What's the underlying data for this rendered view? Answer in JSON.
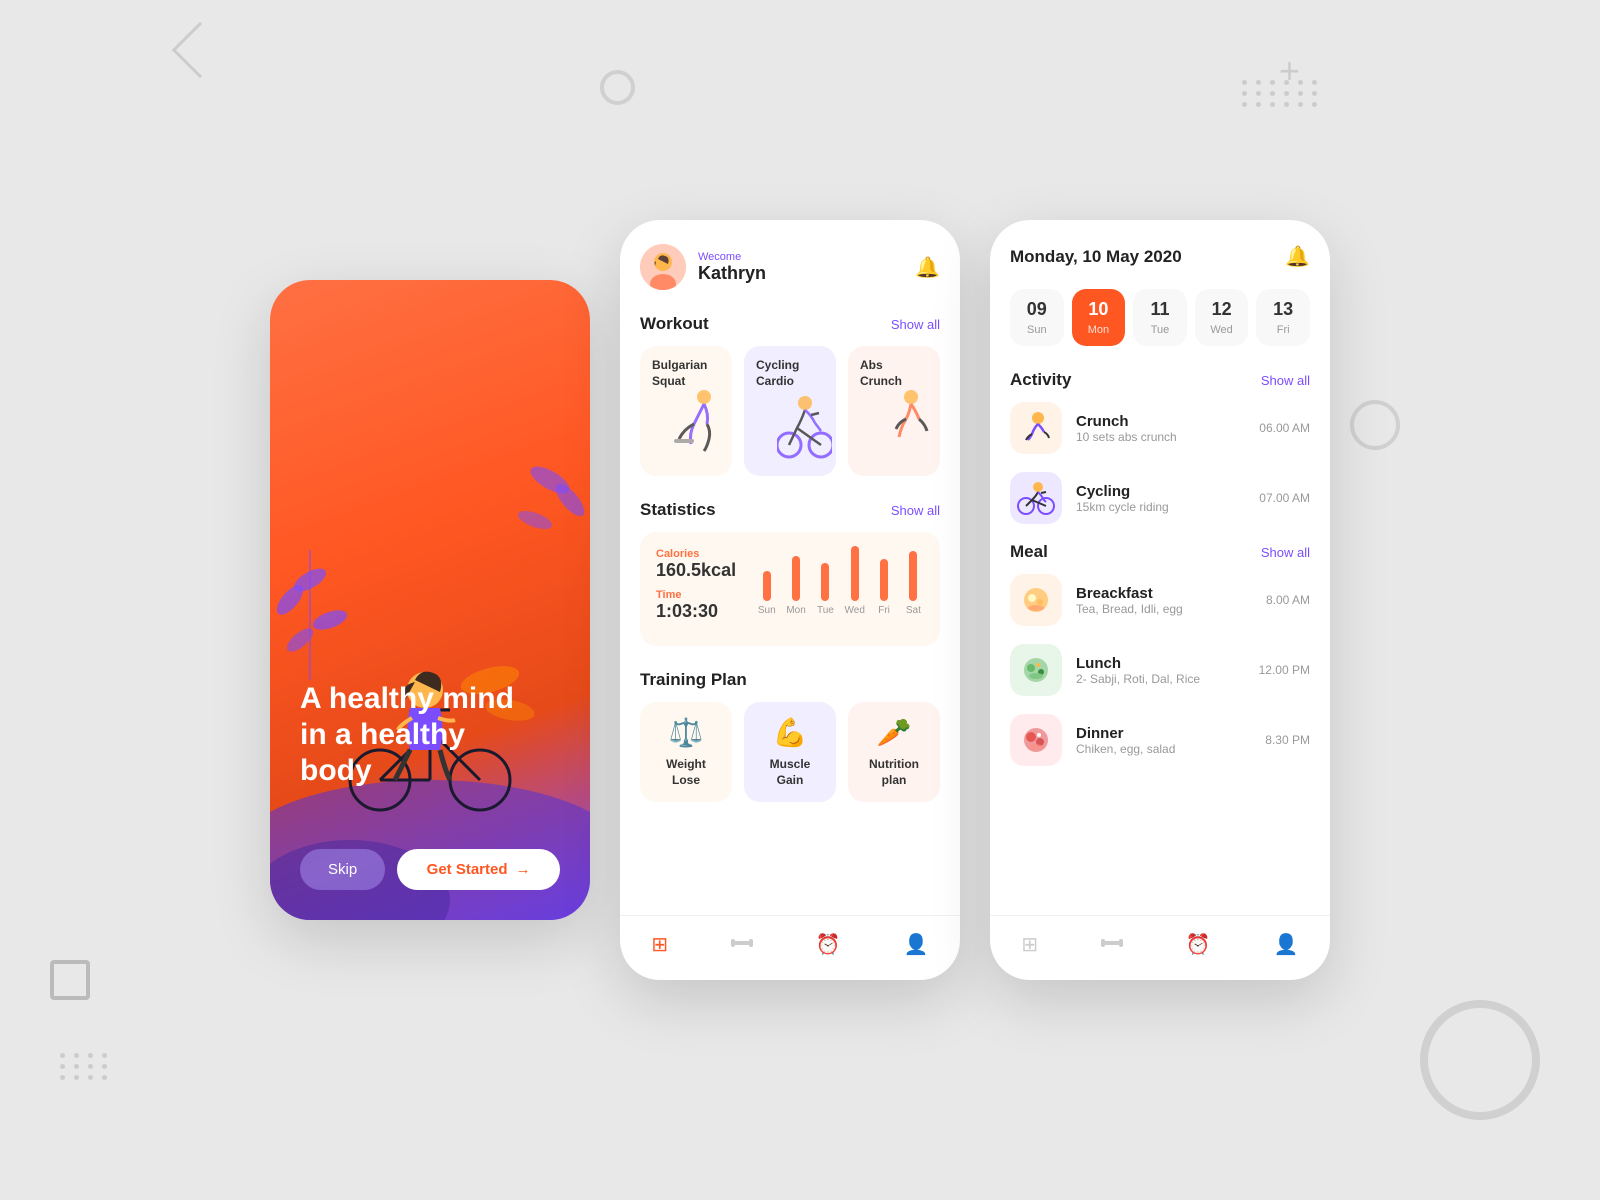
{
  "decorations": {
    "triangle": "▷",
    "plus": "+",
    "circle": "○"
  },
  "phone1": {
    "title_line1": "A healthy mind",
    "title_line2": "in a healthy",
    "title_line3": "body",
    "btn_skip": "Skip",
    "btn_get_started": "Get Started",
    "btn_arrow": "→"
  },
  "phone2": {
    "header": {
      "welcome_label": "Wecome",
      "user_name": "Kathryn"
    },
    "workout": {
      "section_title": "Workout",
      "show_all": "Show all",
      "cards": [
        {
          "title": "Bulgarian Squat",
          "bg": "cream",
          "emoji": "🏋️"
        },
        {
          "title": "Cycling Cardio",
          "bg": "lavender",
          "emoji": "🚴"
        },
        {
          "title": "Abs Crunch",
          "bg": "peach",
          "emoji": "💪"
        }
      ]
    },
    "statistics": {
      "section_title": "Statistics",
      "show_all": "Show all",
      "calories_label": "Calories",
      "calories_value": "160.5kcal",
      "time_label": "Time",
      "time_value": "1:03:30",
      "chart": {
        "days": [
          "Sun",
          "Mon",
          "Tue",
          "Wed",
          "Fri",
          "Sat"
        ],
        "heights": [
          30,
          45,
          38,
          55,
          42,
          50
        ]
      }
    },
    "training_plan": {
      "section_title": "Training Plan",
      "plans": [
        {
          "label": "Weight Lose",
          "icon": "⚖️",
          "bg": "cream"
        },
        {
          "label": "Muscle Gain",
          "icon": "💪",
          "bg": "purple-bg"
        },
        {
          "label": "Nutrition plan",
          "icon": "🥕",
          "bg": "pink-bg"
        }
      ]
    },
    "bottom_nav": {
      "icons": [
        "⊞",
        "⊟",
        "⏰",
        "👤"
      ]
    }
  },
  "phone3": {
    "header": {
      "date_title": "Monday, 10 May 2020"
    },
    "calendar": {
      "days": [
        {
          "num": "09",
          "name": "Sun",
          "active": false
        },
        {
          "num": "10",
          "name": "Mon",
          "active": true
        },
        {
          "num": "11",
          "name": "Tue",
          "active": false
        },
        {
          "num": "12",
          "name": "Wed",
          "active": false
        },
        {
          "num": "13",
          "name": "Fri",
          "active": false
        }
      ]
    },
    "activity": {
      "section_title": "Activity",
      "show_all": "Show all",
      "items": [
        {
          "name": "Crunch",
          "desc": "10 sets abs crunch",
          "time": "06.00 AM",
          "icon": "🏃",
          "thumb_bg": ""
        },
        {
          "name": "Cycling",
          "desc": "15km cycle riding",
          "time": "07.00 AM",
          "icon": "🚴",
          "thumb_bg": "purple"
        }
      ]
    },
    "meal": {
      "section_title": "Meal",
      "show_all": "Show all",
      "items": [
        {
          "name": "Breackfast",
          "desc": "Tea, Bread, Idli, egg",
          "time": "8.00 AM",
          "icon": "🍳",
          "thumb_bg": ""
        },
        {
          "name": "Lunch",
          "desc": "2- Sabji, Roti, Dal, Rice",
          "time": "12.00 PM",
          "icon": "🥗",
          "thumb_bg": "green"
        },
        {
          "name": "Dinner",
          "desc": "Chiken, egg, salad",
          "time": "8.30 PM",
          "icon": "🍽️",
          "thumb_bg": "red"
        }
      ]
    },
    "bottom_nav": {
      "icons": [
        "⊞",
        "⊟",
        "⏰",
        "👤"
      ],
      "active_index": 2
    }
  }
}
